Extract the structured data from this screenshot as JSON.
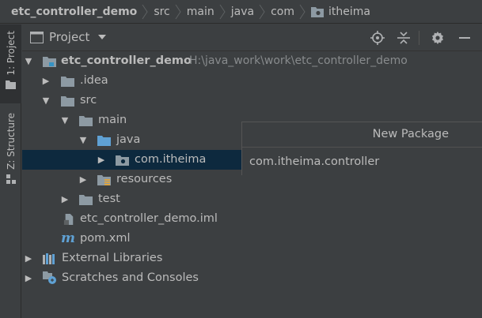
{
  "breadcrumb": [
    "etc_controller_demo",
    "src",
    "main",
    "java",
    "com",
    "itheima"
  ],
  "side_strip": {
    "project": "1: Project",
    "structure": "Z: Structure"
  },
  "panel": {
    "title": "Project"
  },
  "tree": {
    "root": {
      "label": "etc_controller_demo",
      "path": "H:\\java_work\\work\\etc_controller_demo"
    },
    "idea": ".idea",
    "src": "src",
    "main": "main",
    "java": "java",
    "pkg": "com.itheima",
    "resources": "resources",
    "test": "test",
    "iml": "etc_controller_demo.iml",
    "pom": "pom.xml",
    "ext": "External Libraries",
    "scratch": "Scratches and Consoles"
  },
  "popup": {
    "title": "New Package",
    "value": "com.itheima.controller"
  },
  "colors": {
    "folder": "#8d9aa3",
    "source_folder": "#5fa1d4",
    "selection": "#0d293e",
    "background": "#3c3f41"
  }
}
